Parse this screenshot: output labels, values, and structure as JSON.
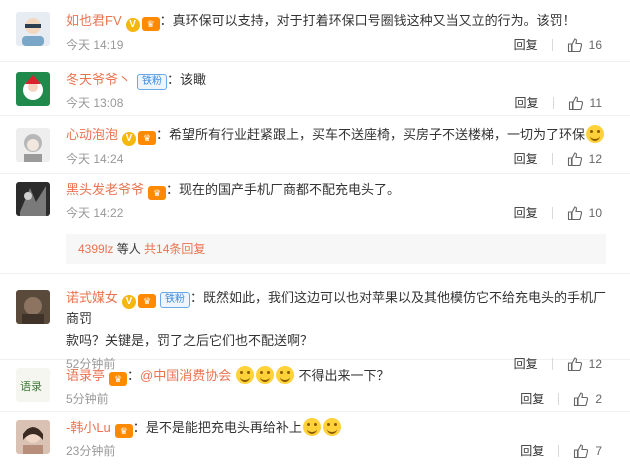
{
  "comments": [
    {
      "name": "如也君FV",
      "text": "真环保可以支持，对于打着环保口号圈钱这种又当又立的行为。该罚！",
      "time": "今天 14:19",
      "reply_label": "回复",
      "likes": "16"
    },
    {
      "name": "冬天爷爷丶",
      "badge": "铁粉",
      "text": "该瞰",
      "time": "今天 13:08",
      "reply_label": "回复",
      "likes": "11"
    },
    {
      "name": "心动泡泡",
      "text": "希望所有行业赶紧跟上，买车不送座椅，买房子不送楼梯，一切为了环保",
      "time": "今天 14:24",
      "reply_label": "回复",
      "likes": "12"
    },
    {
      "name": "黑头发老爷爷",
      "text": "现在的国产手机厂商都不配充电头了。",
      "time": "今天 14:22",
      "reply_label": "回复",
      "likes": "10",
      "sub_user": "4399lz",
      "sub_mid": " 等人 ",
      "sub_link": "共14条回复"
    },
    {
      "name": "诺式媒女",
      "badge": "铁粉",
      "text": "既然如此，我们这边可以也对苹果以及其他模仿它不给充电头的手机厂商罚",
      "text2": "款吗？关键是，罚了之后它们也不配送啊？",
      "time": "52分钟前",
      "reply_label": "回复",
      "likes": "12"
    },
    {
      "name": "语录亭",
      "mention": "@中国消费协会",
      "text": " 不得出来一下？",
      "time": "5分钟前",
      "reply_label": "回复",
      "likes": "2"
    },
    {
      "name": "-韩小Lu",
      "text": "是不是能把充电头再给补上",
      "time": "23分钟前",
      "reply_label": "回复",
      "likes": "7"
    }
  ],
  "colon": "：",
  "v_badge": "V",
  "vip_badge": "♛",
  "colors": {
    "name": "#eb7350",
    "badge_v": "#f5b60f",
    "iron_badge": "#3c8be0"
  },
  "icons": {
    "like": "thumbs-up-icon",
    "emoji": "smile-emoji-icon"
  }
}
